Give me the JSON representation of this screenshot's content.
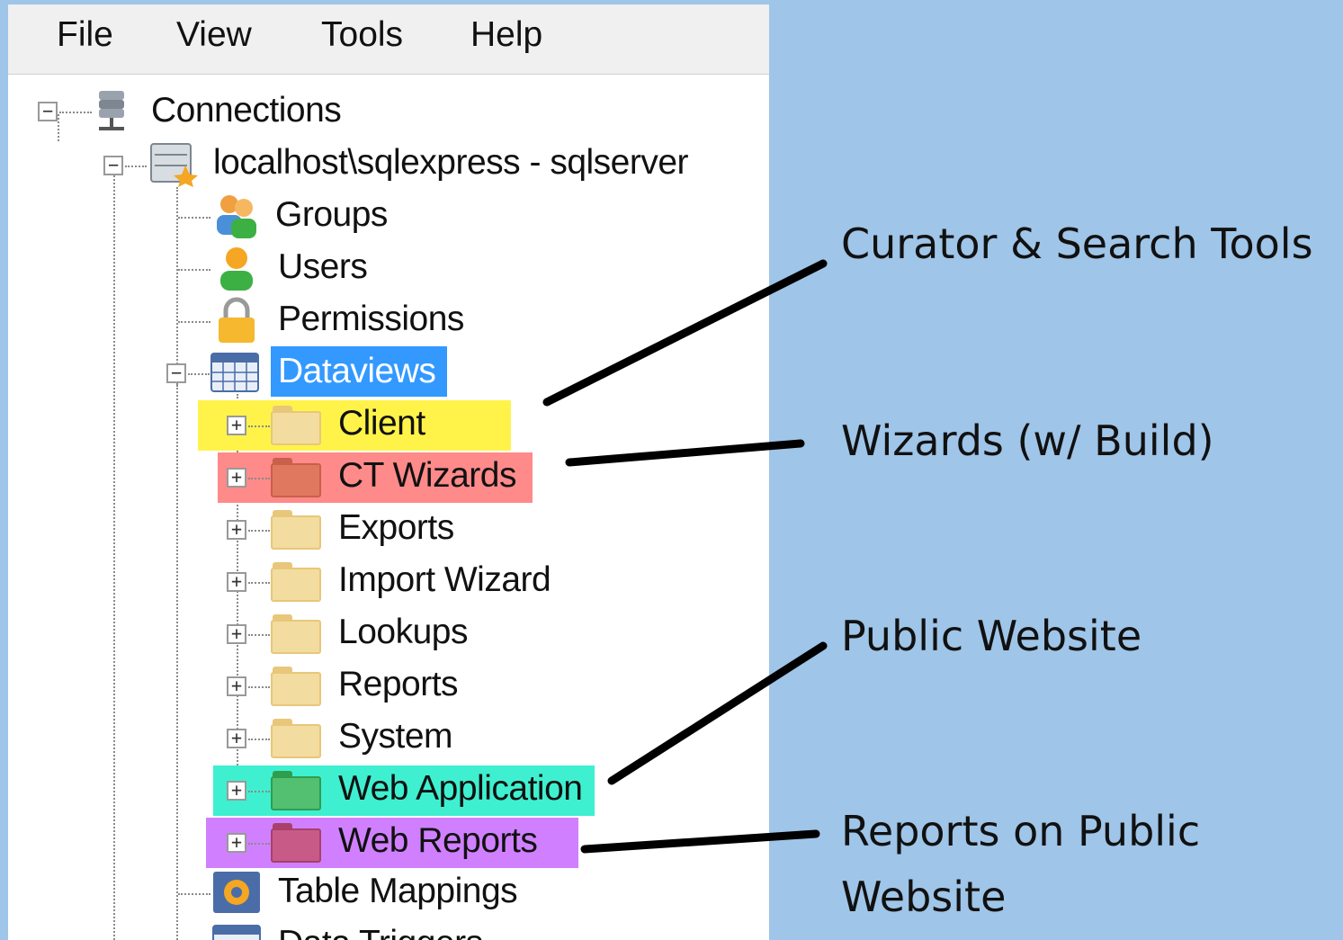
{
  "menu": {
    "file": "File",
    "view": "View",
    "tools": "Tools",
    "help": "Help"
  },
  "tree": {
    "connections": "Connections",
    "server": "localhost\\sqlexpress - sqlserver",
    "groups": "Groups",
    "users": "Users",
    "permissions": "Permissions",
    "dataviews": "Dataviews",
    "folders": [
      {
        "label": "Client",
        "icon": "folder-icon",
        "highlight": "#fff34a"
      },
      {
        "label": "CT Wizards",
        "icon": "folder-red-icon",
        "highlight": "#ff8a8a"
      },
      {
        "label": "Exports",
        "icon": "folder-icon",
        "highlight": ""
      },
      {
        "label": "Import Wizard",
        "icon": "folder-icon",
        "highlight": ""
      },
      {
        "label": "Lookups",
        "icon": "folder-icon",
        "highlight": ""
      },
      {
        "label": "Reports",
        "icon": "folder-icon",
        "highlight": ""
      },
      {
        "label": "System",
        "icon": "folder-icon",
        "highlight": ""
      },
      {
        "label": "Web Application",
        "icon": "folder-green-icon",
        "highlight": "#3ef0d0"
      },
      {
        "label": "Web Reports",
        "icon": "folder-purple-icon",
        "highlight": "#d080ff"
      }
    ],
    "table_mappings": "Table Mappings",
    "data_triggers": "Data Triggers",
    "selected_color": "#3399ff"
  },
  "annotations": {
    "curator": "Curator & Search Tools",
    "wizards": "Wizards (w/ Build)",
    "public_website": "Public Website",
    "reports_line1": "Reports on Public",
    "reports_line2": "Website"
  }
}
